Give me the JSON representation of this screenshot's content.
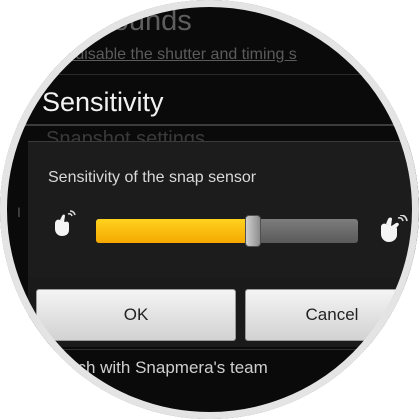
{
  "background": {
    "section_title": "d sounds",
    "section_subtitle": "o disable the shutter and timing s",
    "ghost_item": "Snapshot settings",
    "bottom_item": "uch with Snapmera's team"
  },
  "dialog": {
    "title": "Sensitivity",
    "label": "Sensitivity of the snap sensor",
    "slider": {
      "value_fraction": 0.6,
      "low_icon": "gentle-snap-hand-icon",
      "high_icon": "strong-snap-hand-icon"
    },
    "ok_label": "OK",
    "cancel_label": "Cancel"
  },
  "colors": {
    "accent": "#ffc107",
    "background": "#0a0a0a",
    "dialog": "#1c1c1c"
  }
}
